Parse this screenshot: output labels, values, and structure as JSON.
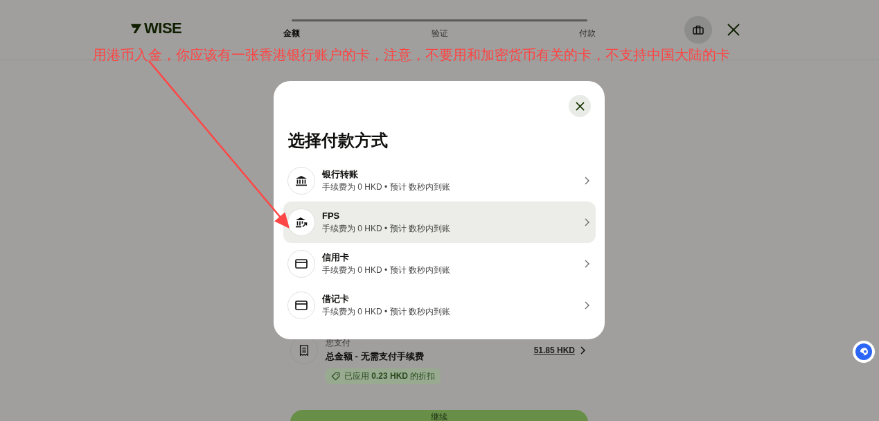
{
  "header": {
    "logo": "WISE",
    "progress": {
      "level": 1
    },
    "steps": [
      {
        "label": "金额",
        "selected": true
      },
      {
        "label": "验证",
        "selected": false
      },
      {
        "label": "付款",
        "selected": false
      }
    ]
  },
  "annotation": {
    "text": "用港币入金，你应该有一张香港银行账户的卡，注意，不要用和加密货币有关的卡，不支持中国大陆的卡"
  },
  "modal": {
    "title": "选择付款方式",
    "methods": [
      {
        "kind": "bank",
        "name": "银行转账",
        "detail": "手续费为 0 HKD • 预计 数秒内到账",
        "selected": false
      },
      {
        "kind": "fps",
        "name": "FPS",
        "detail": "手续费为 0 HKD • 预计 数秒内到账",
        "selected": true
      },
      {
        "kind": "card",
        "name": "信用卡",
        "detail": "手续费为 0 HKD • 预计 数秒内到账",
        "selected": false
      },
      {
        "kind": "card",
        "name": "借记卡",
        "detail": "手续费为 0 HKD • 预计 数秒内到账",
        "selected": false
      }
    ]
  },
  "summary": {
    "caption": "您支付",
    "title": "总金额 - 无需支付手续费",
    "amount": "51.85 HKD",
    "discount": "已应用 **0.23 HKD** 的折扣"
  },
  "continue_button": "继续"
}
